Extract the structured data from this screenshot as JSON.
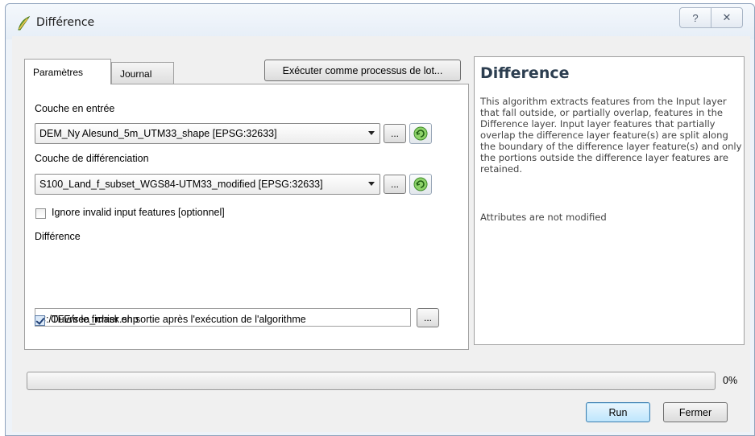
{
  "window": {
    "title": "Différence",
    "help_glyph": "?",
    "close_glyph": "✕"
  },
  "tabs": {
    "params_label": "Paramètres",
    "journal_label": "Journal",
    "batch_button_label": "Exécuter comme processus de lot..."
  },
  "form": {
    "input_layer_label": "Couche en entrée",
    "input_layer_value": "DEM_Ny Alesund_5m_UTM33_shape [EPSG:32633]",
    "overlay_layer_label": "Couche de différenciation",
    "overlay_layer_value": "S100_Land_f_subset_WGS84-UTM33_modified [EPSG:32633]",
    "ignore_invalid_label": "Ignore invalid input features [optionnel]",
    "ignore_invalid_checked": false,
    "output_label": "Différence",
    "output_value": "C:/TFE/sea_mask.shp",
    "open_output_label": "Ouvrir le fichier en sortie après l'exécution de l'algorithme",
    "open_output_checked": true,
    "browse_label": "..."
  },
  "help": {
    "title": "Difference",
    "description": "This algorithm extracts features from the Input layer that fall outside, or partially overlap, features in the Difference layer. Input layer features that partially overlap the difference layer feature(s) are split along the boundary of the difference layer feature(s) and only the portions outside the difference layer features are retained.",
    "attributes_note": "Attributes are not modified"
  },
  "progress": {
    "value": 0,
    "label": "0%"
  },
  "buttons": {
    "run_label": "Run",
    "close_label": "Fermer"
  },
  "colors": {
    "accent": "#3c7fb1",
    "progress_fill": "#3dbd3a",
    "help_title": "#2c3e50"
  }
}
